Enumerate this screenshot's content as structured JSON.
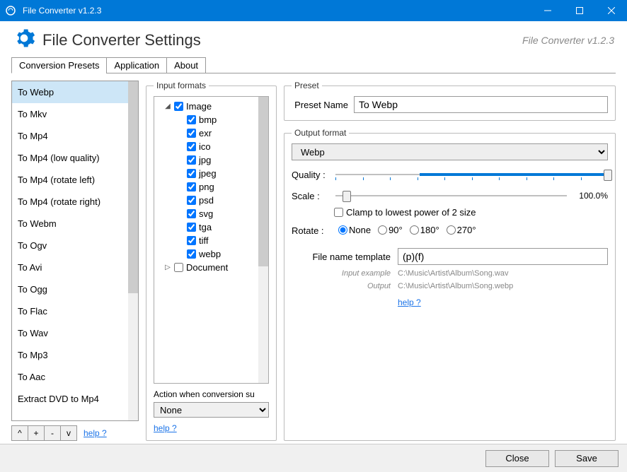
{
  "titlebar": {
    "title": "File Converter v1.2.3"
  },
  "header": {
    "title": "File Converter Settings",
    "version": "File Converter v1.2.3"
  },
  "tabs": [
    "Conversion Presets",
    "Application",
    "About"
  ],
  "presets": [
    "To Webp",
    "To Mkv",
    "To Mp4",
    "To Mp4 (low quality)",
    "To Mp4 (rotate left)",
    "To Mp4 (rotate right)",
    "To Webm",
    "To Ogv",
    "To Avi",
    "To Ogg",
    "To Flac",
    "To Wav",
    "To Mp3",
    "To Aac",
    "Extract DVD to Mp4"
  ],
  "list_buttons": {
    "up": "^",
    "add": "+",
    "remove": "-",
    "down": "v",
    "help": "help ?"
  },
  "preset_panel": {
    "legend": "Preset",
    "name_label": "Preset Name",
    "name_value": "To Webp"
  },
  "input_formats": {
    "legend": "Input formats",
    "groups": [
      {
        "name": "Image",
        "expanded": true,
        "checked": true,
        "items": [
          {
            "name": "bmp",
            "checked": true
          },
          {
            "name": "exr",
            "checked": true
          },
          {
            "name": "ico",
            "checked": true
          },
          {
            "name": "jpg",
            "checked": true
          },
          {
            "name": "jpeg",
            "checked": true
          },
          {
            "name": "png",
            "checked": true
          },
          {
            "name": "psd",
            "checked": true
          },
          {
            "name": "svg",
            "checked": true
          },
          {
            "name": "tga",
            "checked": true
          },
          {
            "name": "tiff",
            "checked": true
          },
          {
            "name": "webp",
            "checked": true
          }
        ]
      },
      {
        "name": "Document",
        "expanded": false,
        "checked": false,
        "items": []
      }
    ],
    "action_label": "Action when conversion su",
    "action_value": "None",
    "help": "help ?"
  },
  "output": {
    "legend": "Output format",
    "format": "Webp",
    "quality_label": "Quality :",
    "quality_pct": 100,
    "quality_fill_start_pct": 31,
    "scale_label": "Scale :",
    "scale_value": "100.0%",
    "scale_handle_pct": 5,
    "clamp_label": "Clamp to lowest power of 2 size",
    "clamp_checked": false,
    "rotate_label": "Rotate :",
    "rotate_options": [
      "None",
      "90°",
      "180°",
      "270°"
    ],
    "rotate_selected": "None",
    "template_label": "File name template",
    "template_value": "(p)(f)",
    "input_example_label": "Input example",
    "input_example": "C:\\Music\\Artist\\Album\\Song.wav",
    "output_example_label": "Output",
    "output_example": "C:\\Music\\Artist\\Album\\Song.webp",
    "help": "help ?"
  },
  "footer": {
    "close": "Close",
    "save": "Save"
  }
}
